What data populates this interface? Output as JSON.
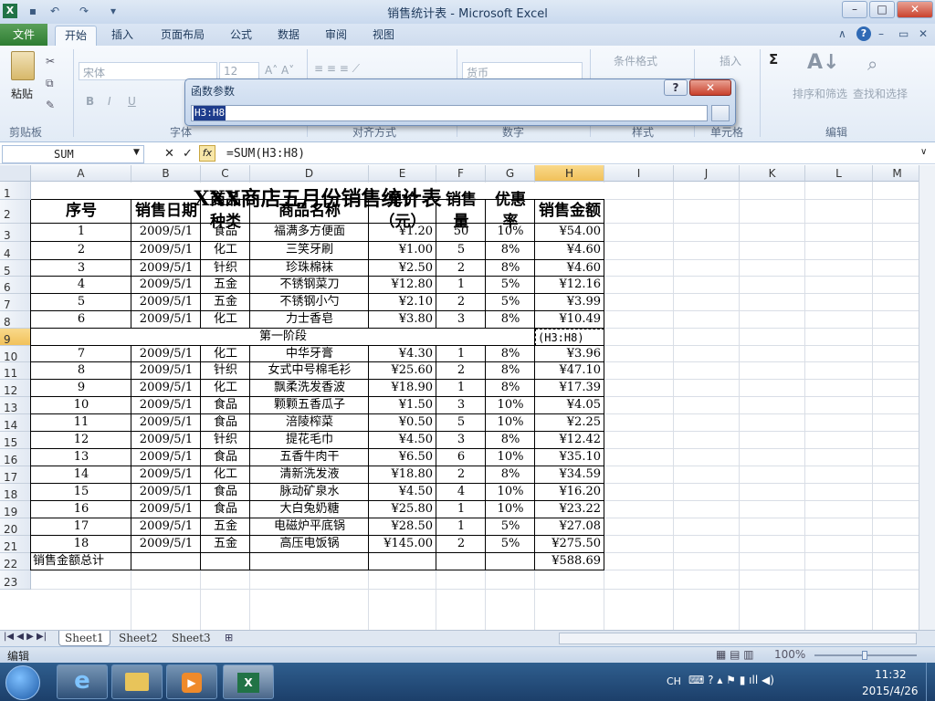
{
  "window": {
    "title": "销售统计表 - Microsoft Excel"
  },
  "tabs": [
    "文件",
    "开始",
    "插入",
    "页面布局",
    "公式",
    "数据",
    "审阅",
    "视图"
  ],
  "ribbon": {
    "clipboard_group": "剪贴板",
    "paste": "粘贴",
    "font_group": "字体",
    "font_name": "宋体",
    "font_size": "12",
    "align_group": "对齐方式",
    "number_group": "数字",
    "number_format": "货币",
    "styles_group": "样式",
    "cond_format": "条件格式",
    "cells_group": "单元格",
    "insert": "插入",
    "edit_group": "编辑",
    "sort_filter": "排序和筛选",
    "find_select": "查找和选择",
    "bold": "B",
    "italic": "I",
    "underline": "U",
    "sigma": "Σ"
  },
  "dialog": {
    "title": "函数参数",
    "input_value": "H3:H8",
    "help": "?",
    "close": "✕"
  },
  "formula_bar": {
    "name_box": "SUM",
    "formula": "=SUM(H3:H8)",
    "fx": "fx",
    "cancel": "✕",
    "enter": "✓"
  },
  "columns": [
    "A",
    "B",
    "C",
    "D",
    "E",
    "F",
    "G",
    "H",
    "I",
    "J",
    "K",
    "L",
    "M"
  ],
  "rows": [
    "1",
    "2",
    "3",
    "4",
    "5",
    "6",
    "7",
    "8",
    "9",
    "10",
    "11",
    "12",
    "13",
    "14",
    "15",
    "16",
    "17",
    "18",
    "19",
    "20",
    "21",
    "22",
    "23"
  ],
  "sheet": {
    "title": "XXX商店五月份销售统计表",
    "headers": [
      "序号",
      "销售日期",
      "商品种类",
      "商品名称",
      "单价（元）",
      "销售量",
      "优惠率",
      "销售金额"
    ],
    "data": [
      [
        "1",
        "2009/5/1",
        "食品",
        "福满多方便面",
        "¥1.20",
        "50",
        "10%",
        "¥54.00"
      ],
      [
        "2",
        "2009/5/1",
        "化工",
        "三笑牙刷",
        "¥1.00",
        "5",
        "8%",
        "¥4.60"
      ],
      [
        "3",
        "2009/5/1",
        "针织",
        "珍珠棉袜",
        "¥2.50",
        "2",
        "8%",
        "¥4.60"
      ],
      [
        "4",
        "2009/5/1",
        "五金",
        "不锈钢菜刀",
        "¥12.80",
        "1",
        "5%",
        "¥12.16"
      ],
      [
        "5",
        "2009/5/1",
        "五金",
        "不锈钢小勺",
        "¥2.10",
        "2",
        "5%",
        "¥3.99"
      ],
      [
        "6",
        "2009/5/1",
        "化工",
        "力士香皂",
        "¥3.80",
        "3",
        "8%",
        "¥10.49"
      ]
    ],
    "stage_label": "第一阶段",
    "stage_value": "(H3:H8)",
    "data2": [
      [
        "7",
        "2009/5/1",
        "化工",
        "中华牙膏",
        "¥4.30",
        "1",
        "8%",
        "¥3.96"
      ],
      [
        "8",
        "2009/5/1",
        "针织",
        "女式中号棉毛衫",
        "¥25.60",
        "2",
        "8%",
        "¥47.10"
      ],
      [
        "9",
        "2009/5/1",
        "化工",
        "飘柔洗发香波",
        "¥18.90",
        "1",
        "8%",
        "¥17.39"
      ],
      [
        "10",
        "2009/5/1",
        "食品",
        "颗颗五香瓜子",
        "¥1.50",
        "3",
        "10%",
        "¥4.05"
      ],
      [
        "11",
        "2009/5/1",
        "食品",
        "涪陵榨菜",
        "¥0.50",
        "5",
        "10%",
        "¥2.25"
      ],
      [
        "12",
        "2009/5/1",
        "针织",
        "提花毛巾",
        "¥4.50",
        "3",
        "8%",
        "¥12.42"
      ],
      [
        "13",
        "2009/5/1",
        "食品",
        "五香牛肉干",
        "¥6.50",
        "6",
        "10%",
        "¥35.10"
      ],
      [
        "14",
        "2009/5/1",
        "化工",
        "清新洗发液",
        "¥18.80",
        "2",
        "8%",
        "¥34.59"
      ],
      [
        "15",
        "2009/5/1",
        "食品",
        "脉动矿泉水",
        "¥4.50",
        "4",
        "10%",
        "¥16.20"
      ],
      [
        "16",
        "2009/5/1",
        "食品",
        "大白兔奶糖",
        "¥25.80",
        "1",
        "10%",
        "¥23.22"
      ],
      [
        "17",
        "2009/5/1",
        "五金",
        "电磁炉平底锅",
        "¥28.50",
        "1",
        "5%",
        "¥27.08"
      ],
      [
        "18",
        "2009/5/1",
        "五金",
        "高压电饭锅",
        "¥145.00",
        "2",
        "5%",
        "¥275.50"
      ]
    ],
    "total_label": "销售金额总计",
    "total_value": "¥588.69"
  },
  "sheet_tabs": [
    "Sheet1",
    "Sheet2",
    "Sheet3"
  ],
  "status": {
    "mode": "编辑",
    "zoom": "100%"
  },
  "taskbar": {
    "ime": "CH",
    "time": "11:32",
    "date": "2015/4/26"
  }
}
